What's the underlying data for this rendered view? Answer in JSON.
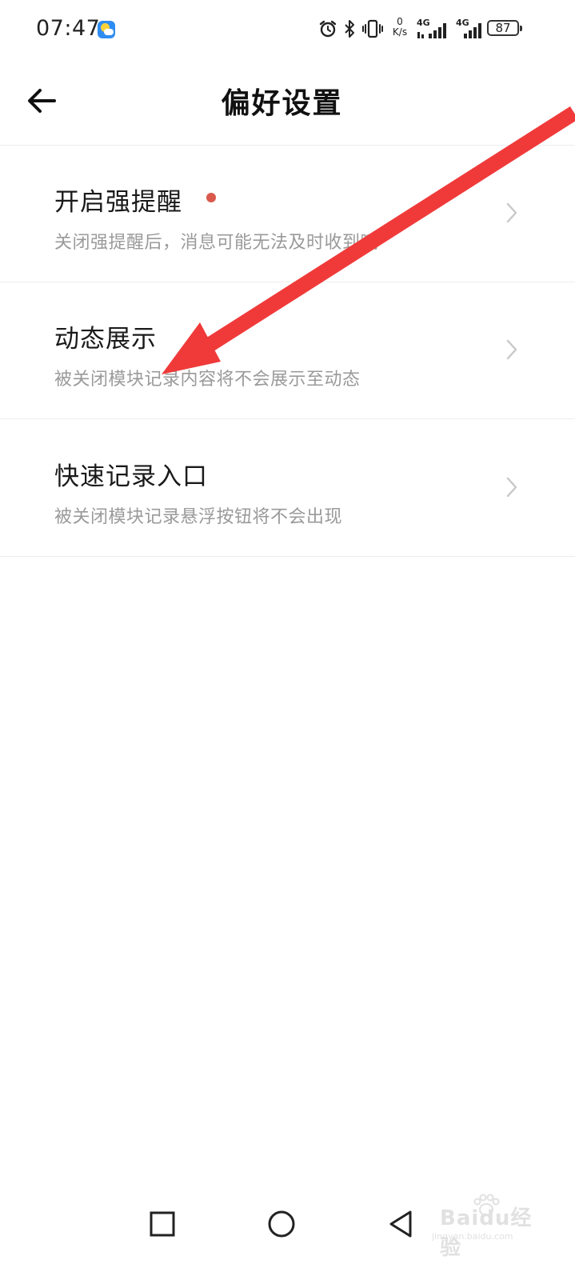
{
  "status_bar": {
    "time": "07:47",
    "net_speed_value": "0",
    "net_speed_unit": "K/s",
    "sim1_label": "4G",
    "sim2_label": "4G",
    "battery_level": "87",
    "icons": [
      "weather-app-icon",
      "alarm-icon",
      "bluetooth-icon",
      "vibrate-icon",
      "signal-icon",
      "signal-icon",
      "battery-icon"
    ]
  },
  "header": {
    "back_icon": "arrow-left-icon",
    "title": "偏好设置"
  },
  "settings": {
    "items": [
      {
        "title": "开启强提醒",
        "description": "关闭强提醒后，消息可能无法及时收到哦",
        "has_red_dot": true
      },
      {
        "title": "动态展示",
        "description": "被关闭模块记录内容将不会展示至动态",
        "has_red_dot": false
      },
      {
        "title": "快速记录入口",
        "description": "被关闭模块记录悬浮按钮将不会出现",
        "has_red_dot": false
      }
    ]
  },
  "nav_bar": {
    "buttons": [
      "recent-apps-square-icon",
      "home-circle-icon",
      "back-triangle-icon"
    ]
  },
  "watermark": {
    "text": "Baidu经验",
    "url_text": "jingyan.baidu.com"
  },
  "colors": {
    "background": "#ffffff",
    "title_text": "#1a1a1a",
    "description_text": "#9a9a9a",
    "red_dot": "#d9594c",
    "annotation_arrow": "#f03a3a",
    "divider": "#ececec"
  }
}
